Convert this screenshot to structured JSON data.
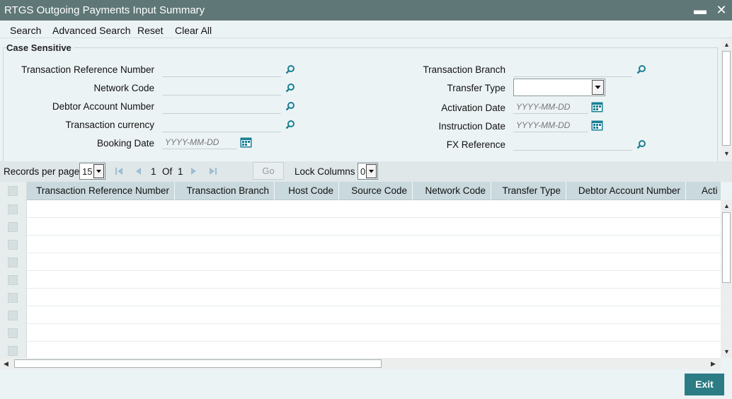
{
  "window": {
    "title": "RTGS Outgoing Payments Input Summary",
    "minimize_glyph": "▬",
    "close_glyph": "✕"
  },
  "toolbar": {
    "search": "Search",
    "advanced_search": "Advanced Search",
    "reset": "Reset",
    "clear_all": "Clear All"
  },
  "criteria": {
    "legend": "Case Sensitive",
    "left": [
      {
        "label": "Transaction Reference Number",
        "value": ""
      },
      {
        "label": "Network Code",
        "value": ""
      },
      {
        "label": "Debtor Account Number",
        "value": ""
      },
      {
        "label": "Transaction currency",
        "value": ""
      },
      {
        "label": "Booking Date",
        "placeholder": "YYYY-MM-DD"
      }
    ],
    "right": [
      {
        "label": "Transaction Branch",
        "value": ""
      },
      {
        "label": "Transfer Type",
        "value": ""
      },
      {
        "label": "Activation Date",
        "placeholder": "YYYY-MM-DD"
      },
      {
        "label": "Instruction Date",
        "placeholder": "YYYY-MM-DD"
      },
      {
        "label": "FX Reference",
        "value": ""
      }
    ]
  },
  "pager": {
    "records_label": "Records per page",
    "records_value": "15",
    "current_page": "1",
    "of_label": "Of",
    "total_pages": "1",
    "go_label": "Go",
    "lock_label": "Lock Columns",
    "lock_value": "0"
  },
  "grid": {
    "columns": [
      "Transaction Reference Number",
      "Transaction Branch",
      "Host Code",
      "Source Code",
      "Network Code",
      "Transfer Type",
      "Debtor Account Number",
      "Acti"
    ]
  },
  "footer": {
    "exit": "Exit"
  },
  "colors": {
    "titlebar": "#5f7777",
    "accent": "#2b7c85",
    "header": "#c9d9de",
    "icon": "#1a7f93"
  }
}
